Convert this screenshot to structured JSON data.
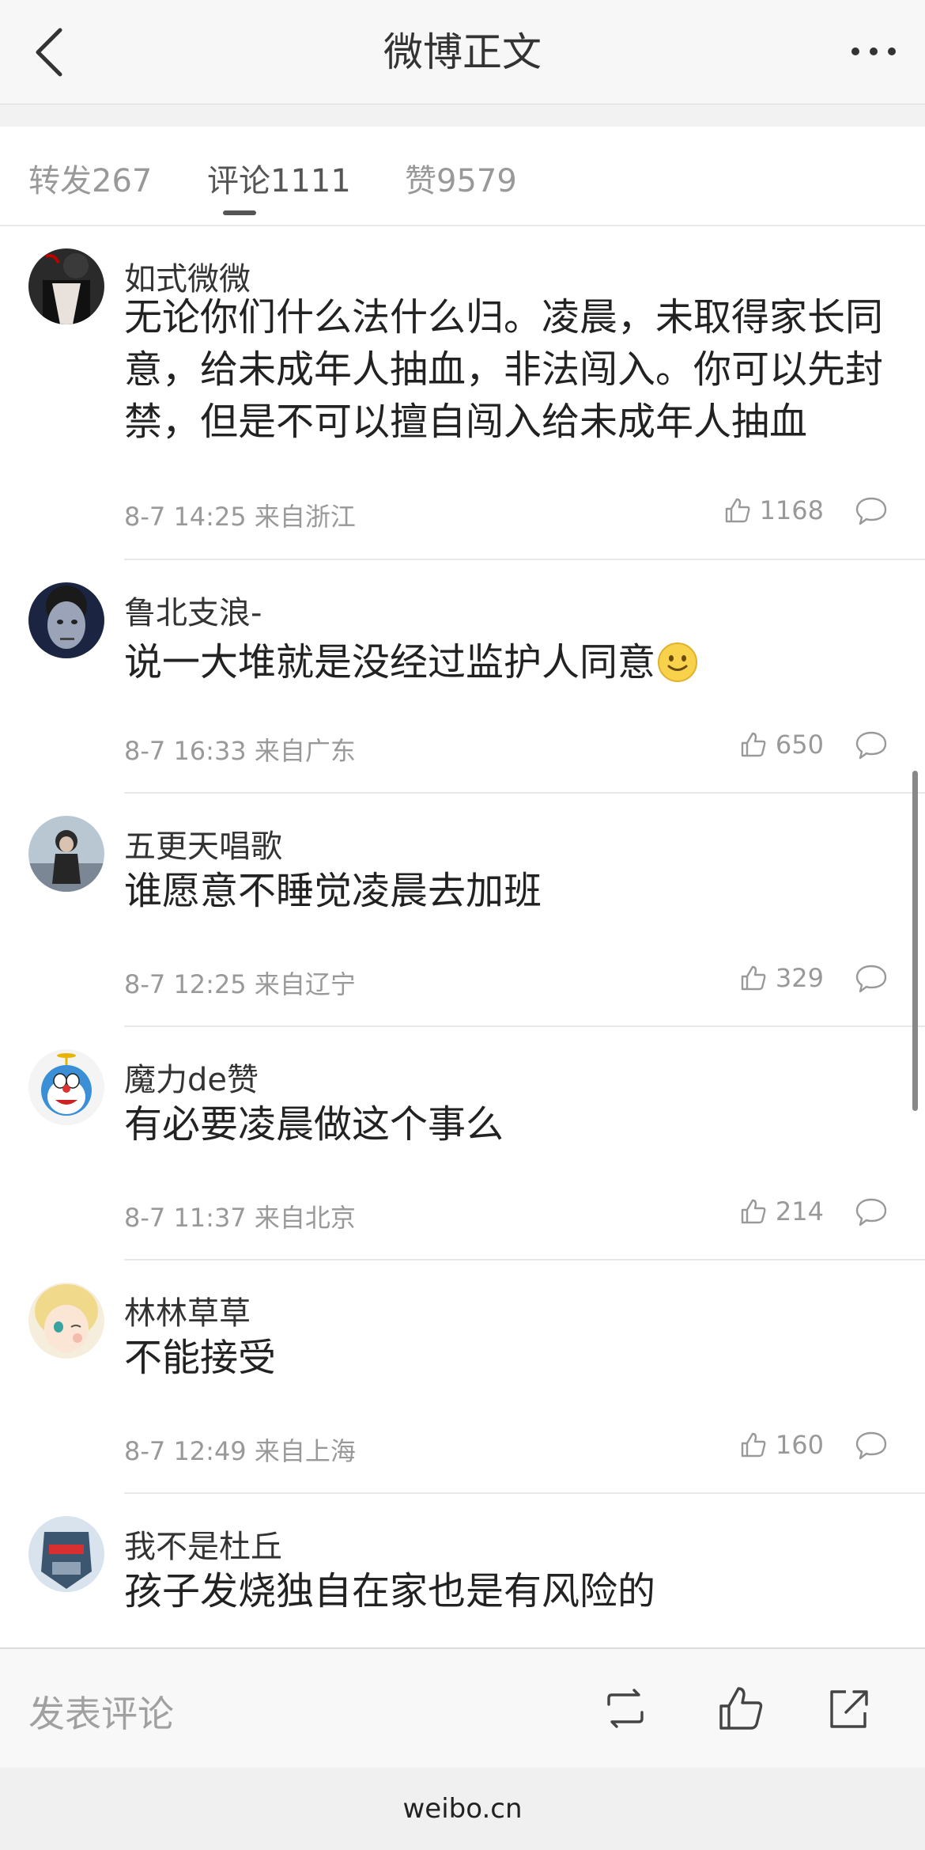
{
  "header": {
    "title": "微博正文"
  },
  "tabs": [
    {
      "label": "转发267"
    },
    {
      "label": "评论1111"
    },
    {
      "label": "赞9579"
    }
  ],
  "comments": [
    {
      "name": "如式微微",
      "text": "无论你们什么法什么归。凌晨，未取得家长同意，给未成年人抽血，非法闯入。你可以先封禁，但是不可以擅自闯入给未成年人抽血",
      "meta": "8-7 14:25 来自浙江",
      "likes": "1168"
    },
    {
      "name": "鲁北支浪-",
      "text": "说一大堆就是没经过监护人同意",
      "meta": "8-7 16:33 来自广东",
      "likes": "650"
    },
    {
      "name": "五更天唱歌",
      "text": "谁愿意不睡觉凌晨去加班",
      "meta": "8-7 12:25 来自辽宁",
      "likes": "329"
    },
    {
      "name": "魔力de赞",
      "text": "有必要凌晨做这个事么",
      "meta": "8-7 11:37 来自北京",
      "likes": "214"
    },
    {
      "name": "林林草草",
      "text": "不能接受",
      "meta": "8-7 12:49 来自上海",
      "likes": "160"
    },
    {
      "name": "我不是杜丘",
      "text": "孩子发烧独自在家也是有风险的",
      "meta": "",
      "likes": ""
    }
  ],
  "actionbar": {
    "placeholder": "发表评论"
  },
  "browser": {
    "url": "weibo.cn"
  }
}
